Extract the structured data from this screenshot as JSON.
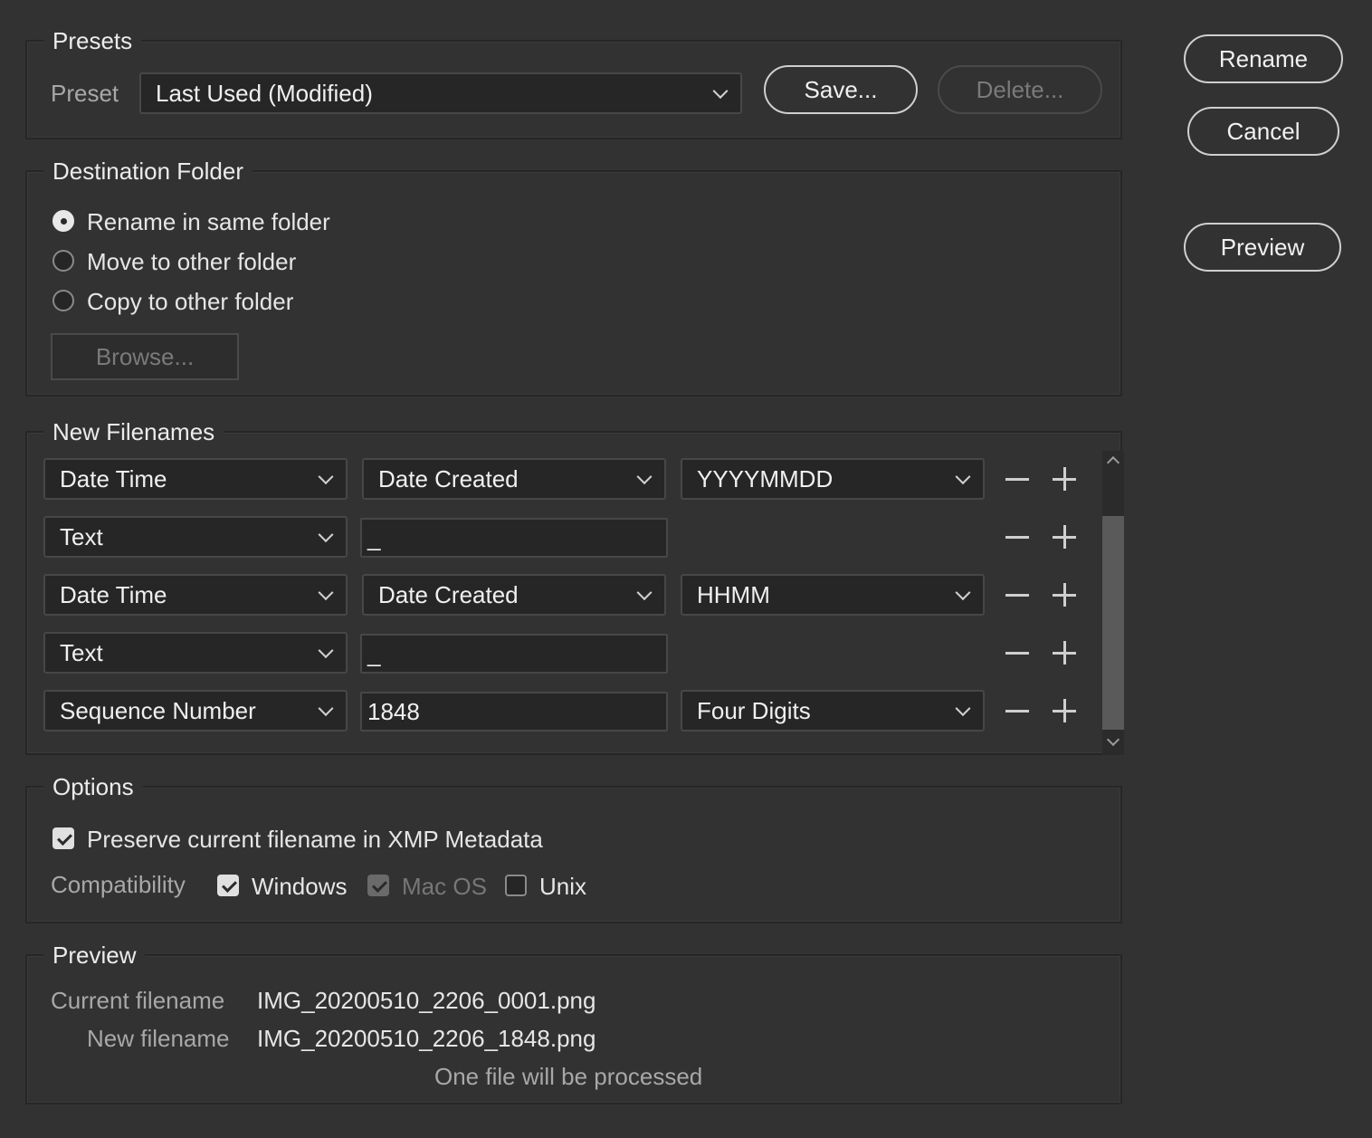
{
  "presets": {
    "legend": "Presets",
    "preset_label": "Preset",
    "preset_value": "Last Used (Modified)",
    "save_label": "Save...",
    "delete_label": "Delete..."
  },
  "actions": {
    "rename_label": "Rename",
    "cancel_label": "Cancel",
    "preview_label": "Preview"
  },
  "destination": {
    "legend": "Destination Folder",
    "options": [
      {
        "label": "Rename in same folder",
        "selected": true
      },
      {
        "label": "Move to other folder",
        "selected": false
      },
      {
        "label": "Copy to other folder",
        "selected": false
      }
    ],
    "browse_label": "Browse..."
  },
  "new_filenames": {
    "legend": "New Filenames",
    "rows": [
      {
        "type": "Date Time",
        "field2": "Date Created",
        "field3": "YYYYMMDD"
      },
      {
        "type": "Text",
        "text_value": "_"
      },
      {
        "type": "Date Time",
        "field2": "Date Created",
        "field3": "HHMM"
      },
      {
        "type": "Text",
        "text_value": "_"
      },
      {
        "type": "Sequence Number",
        "text_value": "1848",
        "field3": "Four Digits"
      }
    ]
  },
  "options": {
    "legend": "Options",
    "preserve_label": "Preserve current filename in XMP Metadata",
    "preserve_checked": true,
    "compatibility_label": "Compatibility",
    "windows_label": "Windows",
    "windows_checked": true,
    "macos_label": "Mac OS",
    "macos_checked": true,
    "unix_label": "Unix",
    "unix_checked": false
  },
  "preview": {
    "legend": "Preview",
    "current_label": "Current filename",
    "current_value": "IMG_20200510_2206_0001.png",
    "new_label": "New filename",
    "new_value": "IMG_20200510_2206_1848.png",
    "status": "One file will be processed"
  }
}
